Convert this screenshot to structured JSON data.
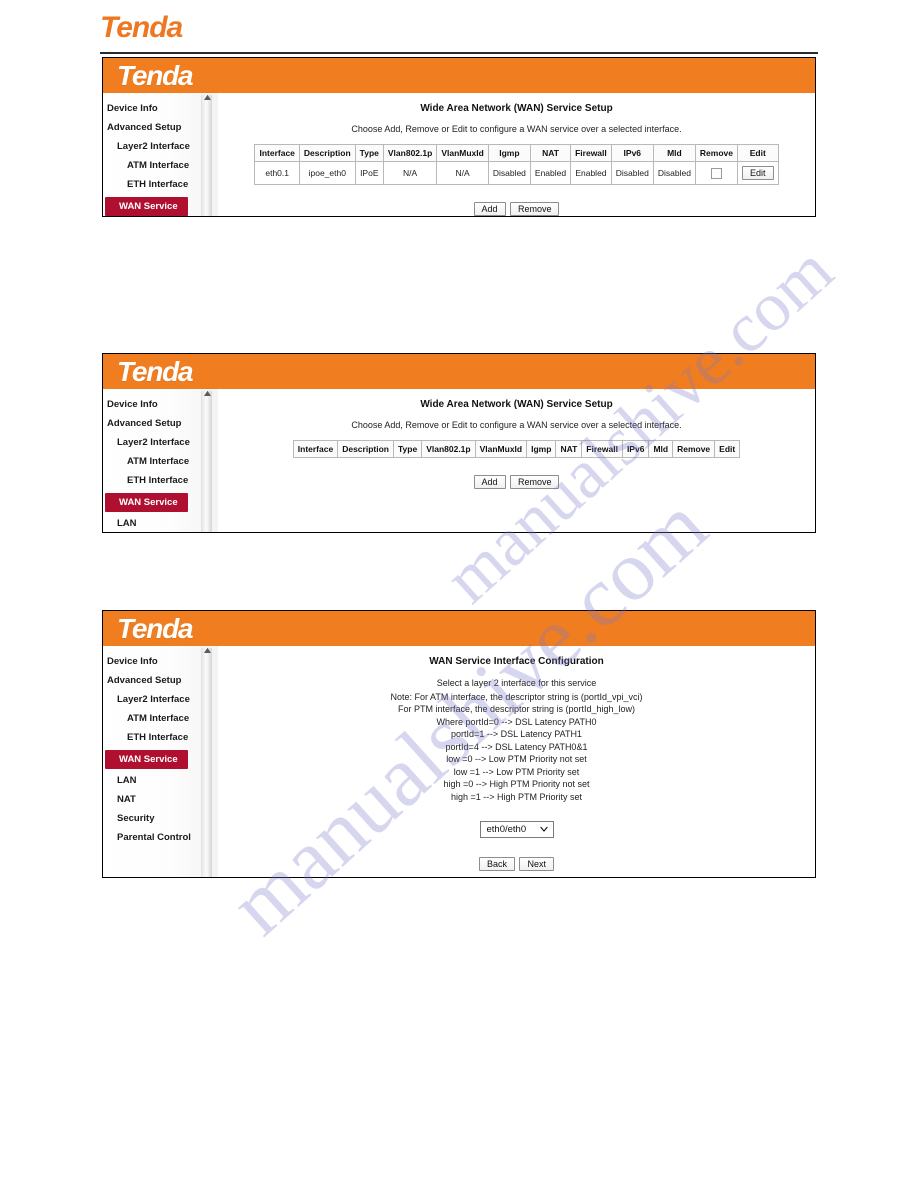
{
  "document": {
    "brand_logo": "Tenda",
    "brand_color": "#EE7722"
  },
  "watermark": {
    "line1": "manualshive.com",
    "line2": "manualshive.com"
  },
  "ui": {
    "logo": "Tenda",
    "header_color": "#F07D20",
    "active_color": "#B01030",
    "scroll_arrow": "▲"
  },
  "sidebar": {
    "items_full": [
      {
        "label": "Device Info",
        "level": 0,
        "active": false
      },
      {
        "label": "Advanced Setup",
        "level": 0,
        "active": false
      },
      {
        "label": "Layer2 Interface",
        "level": 1,
        "active": false
      },
      {
        "label": "ATM Interface",
        "level": 2,
        "active": false
      },
      {
        "label": "ETH Interface",
        "level": 2,
        "active": false
      },
      {
        "label": "WAN Service",
        "level": 1,
        "active": true
      },
      {
        "label": "LAN",
        "level": 1,
        "active": false
      },
      {
        "label": "NAT",
        "level": 1,
        "active": false
      },
      {
        "label": "Security",
        "level": 1,
        "active": false
      },
      {
        "label": "Parental Control",
        "level": 1,
        "active": false
      }
    ],
    "items_short": [
      {
        "label": "Device Info",
        "level": 0,
        "active": false
      },
      {
        "label": "Advanced Setup",
        "level": 0,
        "active": false
      },
      {
        "label": "Layer2 Interface",
        "level": 1,
        "active": false
      },
      {
        "label": "ATM Interface",
        "level": 2,
        "active": false
      },
      {
        "label": "ETH Interface",
        "level": 2,
        "active": false
      },
      {
        "label": "WAN Service",
        "level": 1,
        "active": true
      }
    ],
    "items_medium": [
      {
        "label": "Device Info",
        "level": 0,
        "active": false
      },
      {
        "label": "Advanced Setup",
        "level": 0,
        "active": false
      },
      {
        "label": "Layer2 Interface",
        "level": 1,
        "active": false
      },
      {
        "label": "ATM Interface",
        "level": 2,
        "active": false
      },
      {
        "label": "ETH Interface",
        "level": 2,
        "active": false
      },
      {
        "label": "WAN Service",
        "level": 1,
        "active": true
      },
      {
        "label": "LAN",
        "level": 1,
        "active": false
      }
    ]
  },
  "panel1": {
    "title": "Wide Area Network (WAN) Service Setup",
    "subtitle": "Choose Add, Remove or Edit to configure a WAN service over a selected interface.",
    "table": {
      "headers": [
        "Interface",
        "Description",
        "Type",
        "Vlan802.1p",
        "VlanMuxId",
        "Igmp",
        "NAT",
        "Firewall",
        "IPv6",
        "Mld",
        "Remove",
        "Edit"
      ],
      "rows": [
        {
          "interface": "eth0.1",
          "description": "ipoe_eth0",
          "type": "IPoE",
          "vlan8021p": "N/A",
          "vlanmuxid": "N/A",
          "igmp": "Disabled",
          "nat": "Enabled",
          "firewall": "Enabled",
          "ipv6": "Disabled",
          "mld": "Disabled",
          "remove": "",
          "edit": "Edit"
        }
      ]
    },
    "buttons": {
      "add": "Add",
      "remove": "Remove"
    }
  },
  "panel2": {
    "title": "Wide Area Network (WAN) Service Setup",
    "subtitle": "Choose Add, Remove or Edit to configure a WAN service over a selected interface.",
    "table": {
      "headers": [
        "Interface",
        "Description",
        "Type",
        "Vlan802.1p",
        "VlanMuxId",
        "Igmp",
        "NAT",
        "Firewall",
        "IPv6",
        "Mld",
        "Remove",
        "Edit"
      ],
      "rows": []
    },
    "buttons": {
      "add": "Add",
      "remove": "Remove"
    }
  },
  "panel3": {
    "title": "WAN Service Interface Configuration",
    "note_lines": [
      "Select a layer 2 interface for this service",
      "Note: For ATM interface, the descriptor string is (portId_vpi_vci)",
      "For PTM interface, the descriptor string is (portId_high_low)",
      "Where portId=0 --> DSL Latency PATH0",
      "portId=1 --> DSL Latency PATH1",
      "portId=4 --> DSL Latency PATH0&1",
      "low =0 --> Low PTM Priority not set",
      "low =1 --> Low PTM Priority set",
      "high =0 --> High PTM Priority not set",
      "high =1 --> High PTM Priority set"
    ],
    "interface_select": {
      "value": "eth0/eth0",
      "chevron": "⌄",
      "options": [
        "eth0/eth0"
      ]
    },
    "buttons": {
      "back": "Back",
      "next": "Next"
    }
  }
}
